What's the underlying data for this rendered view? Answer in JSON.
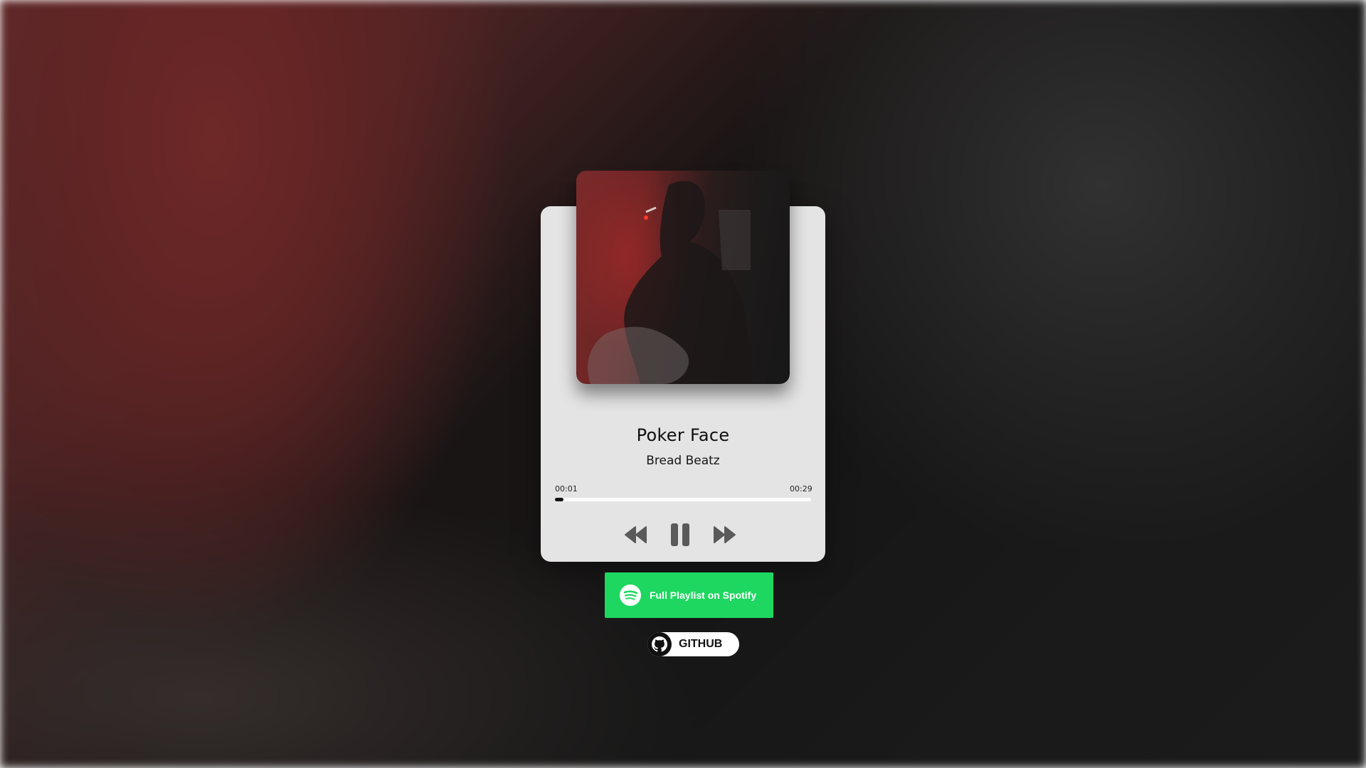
{
  "player": {
    "title": "Poker Face",
    "artist": "Bread Beatz",
    "current_time": "00:01",
    "total_time": "00:29",
    "progress_fraction": 0.034,
    "controls": {
      "prev_icon": "rewind-icon",
      "play_icon": "pause-icon",
      "next_icon": "fast-forward-icon"
    }
  },
  "links": {
    "spotify_label": "Full Playlist on Spotify",
    "spotify_icon": "spotify-icon",
    "spotify_color": "#1ed760",
    "github_label": "GITHUB",
    "github_icon": "github-icon"
  }
}
